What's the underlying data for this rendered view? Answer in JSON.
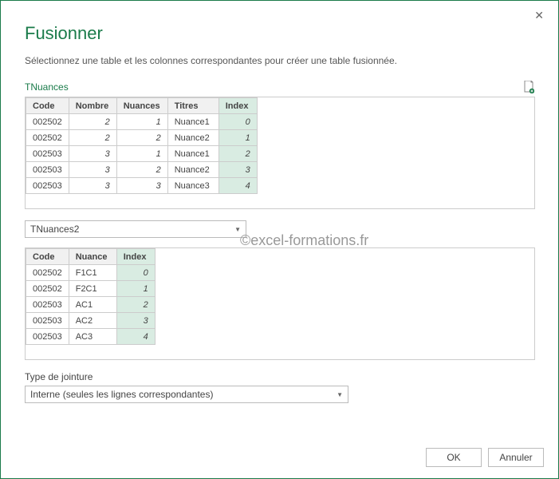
{
  "window": {
    "title": "Fusionner",
    "subtitle": "Sélectionnez une table et les colonnes correspondantes pour créer une table fusionnée."
  },
  "table1": {
    "name": "TNuances",
    "headers": {
      "code": "Code",
      "nombre": "Nombre",
      "nuances": "Nuances",
      "titres": "Titres",
      "index": "Index"
    },
    "rows": [
      {
        "code": "002502",
        "nombre": "2",
        "nuances": "1",
        "titres": "Nuance1",
        "index": "0"
      },
      {
        "code": "002502",
        "nombre": "2",
        "nuances": "2",
        "titres": "Nuance2",
        "index": "1"
      },
      {
        "code": "002503",
        "nombre": "3",
        "nuances": "1",
        "titres": "Nuance1",
        "index": "2"
      },
      {
        "code": "002503",
        "nombre": "3",
        "nuances": "2",
        "titres": "Nuance2",
        "index": "3"
      },
      {
        "code": "002503",
        "nombre": "3",
        "nuances": "3",
        "titres": "Nuance3",
        "index": "4"
      }
    ]
  },
  "dropdown1": {
    "value": "TNuances2"
  },
  "table2": {
    "headers": {
      "code": "Code",
      "nuance": "Nuance",
      "index": "Index"
    },
    "rows": [
      {
        "code": "002502",
        "nuance": "F1C1",
        "index": "0"
      },
      {
        "code": "002502",
        "nuance": "F2C1",
        "index": "1"
      },
      {
        "code": "002503",
        "nuance": "AC1",
        "index": "2"
      },
      {
        "code": "002503",
        "nuance": "AC2",
        "index": "3"
      },
      {
        "code": "002503",
        "nuance": "AC3",
        "index": "4"
      }
    ]
  },
  "join": {
    "label": "Type de jointure",
    "value": "Interne (seules les lignes correspondantes)"
  },
  "buttons": {
    "ok": "OK",
    "cancel": "Annuler"
  },
  "watermark": "©excel-formations.fr"
}
